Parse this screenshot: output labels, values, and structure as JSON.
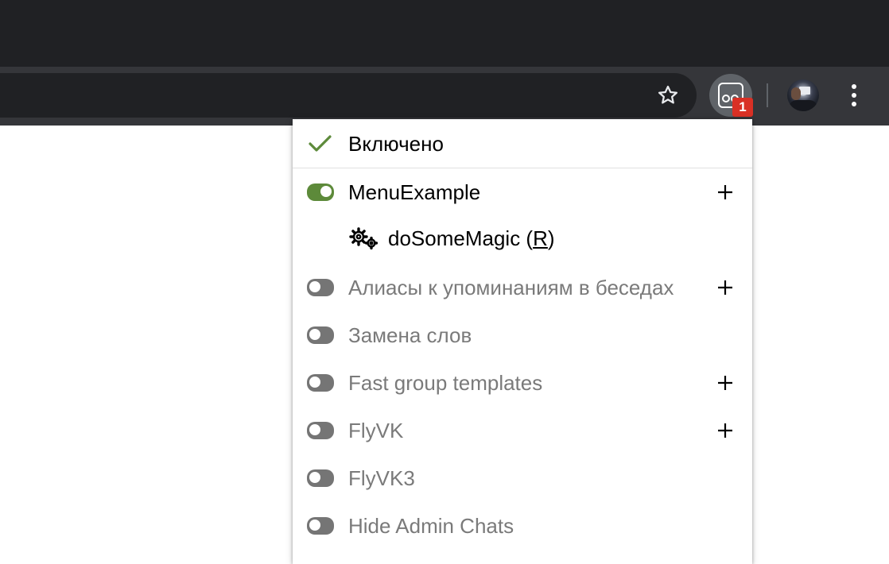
{
  "colors": {
    "tabstrip": "#202124",
    "toolbar": "#35363a",
    "accent_green": "#5d8a3a",
    "badge_red": "#d93025",
    "disabled_text": "#7a7a7a"
  },
  "toolbar": {
    "bookmark_icon": "star-outline-icon",
    "extension_badge": "1",
    "menu_icon": "vertical-dots-icon"
  },
  "popup": {
    "enabled_label": "Включено",
    "items": [
      {
        "label": "MenuExample",
        "enabled": true,
        "has_add": true
      },
      {
        "label": "Алиасы к упоминаниям в беседах",
        "enabled": false,
        "has_add": true
      },
      {
        "label": "Замена слов",
        "enabled": false,
        "has_add": false
      },
      {
        "label": "Fast group templates",
        "enabled": false,
        "has_add": true
      },
      {
        "label": "FlyVK",
        "enabled": false,
        "has_add": true
      },
      {
        "label": "FlyVK3",
        "enabled": false,
        "has_add": false
      },
      {
        "label": "Hide Admin Chats",
        "enabled": false,
        "has_add": false
      }
    ],
    "action": {
      "name": "doSomeMagic",
      "open": " (",
      "hotkey": "R",
      "close": ")",
      "icon": "gears-icon"
    }
  }
}
